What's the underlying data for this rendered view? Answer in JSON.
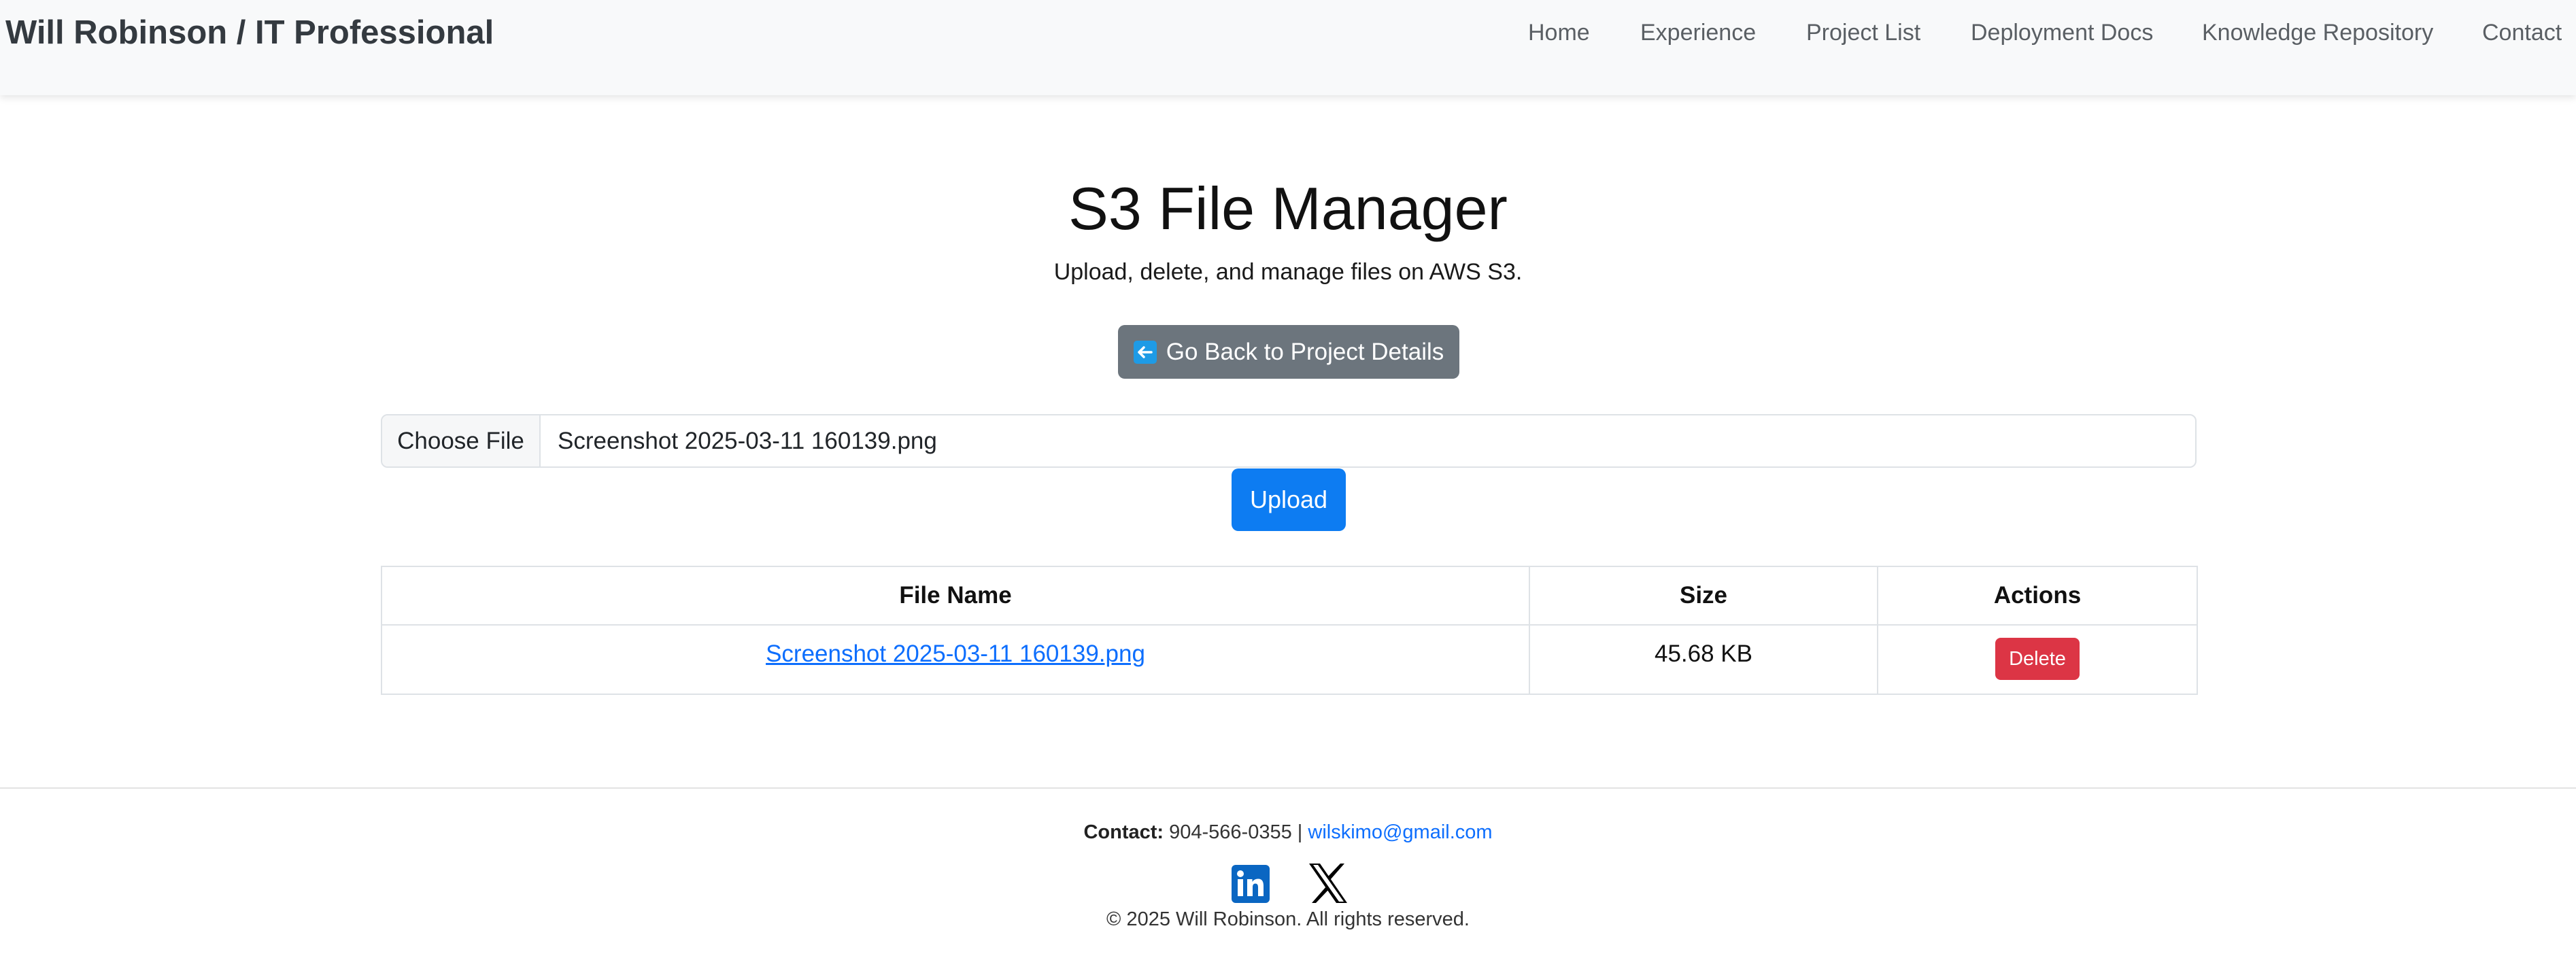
{
  "navbar": {
    "brand": "Will Robinson / IT Professional",
    "links": [
      "Home",
      "Experience",
      "Project List",
      "Deployment Docs",
      "Knowledge Repository",
      "Contact"
    ]
  },
  "main": {
    "title": "S3 File Manager",
    "subtitle": "Upload, delete, and manage files on AWS S3.",
    "back_button": "Go Back to Project Details",
    "back_icon": "left-arrow-icon",
    "file_input": {
      "choose_label": "Choose File",
      "selected_file": "Screenshot 2025-03-11 160139.png"
    },
    "upload_label": "Upload",
    "table": {
      "headers": [
        "File Name",
        "Size",
        "Actions"
      ],
      "rows": [
        {
          "file_name": "Screenshot 2025-03-11 160139.png",
          "size": "45.68 KB",
          "action": "Delete"
        }
      ]
    }
  },
  "footer": {
    "contact_label": "Contact:",
    "phone": "904-566-0355",
    "separator": "|",
    "email": "wilskimo@gmail.com",
    "social_icons": [
      "linkedin-icon",
      "x-icon"
    ],
    "copyright": "© 2025 Will Robinson. All rights reserved."
  },
  "colors": {
    "primary": "#0d7cf2",
    "secondary": "#6c757d",
    "danger": "#dc3545",
    "link": "#0d6efd",
    "navbar_bg": "#f8f9fa"
  }
}
